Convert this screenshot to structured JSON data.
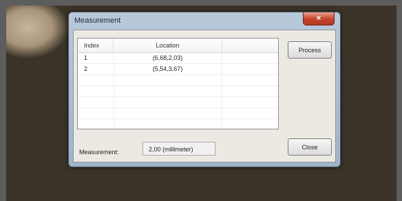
{
  "window": {
    "title": "Measurement",
    "close_glyph": "×"
  },
  "table": {
    "columns": [
      "Index",
      "Location",
      ""
    ],
    "rows": [
      {
        "index": "1",
        "location": "(6,68,2,03)"
      },
      {
        "index": "2",
        "location": "(5,54,3,67)"
      }
    ]
  },
  "buttons": {
    "process": "Process",
    "close": "Close"
  },
  "measurement": {
    "label": "Measurement:",
    "value": "2,00 (millimeter)"
  },
  "colors": {
    "titlebar": "#b9c9db",
    "close_button": "#c5412b",
    "client_background": "#ece9e3"
  },
  "icons": {
    "close": "close-icon"
  }
}
